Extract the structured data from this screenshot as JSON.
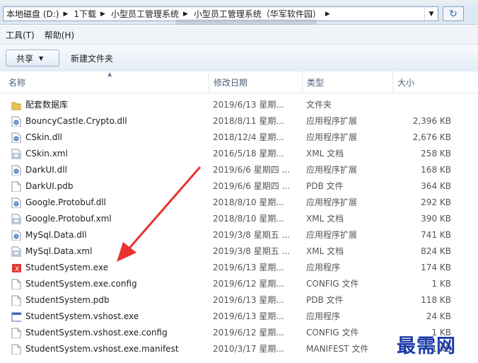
{
  "address": {
    "crumbs": [
      "本地磁盘 (D:)",
      "1下载",
      "小型员工管理系统",
      "小型员工管理系统（华军软件园）"
    ],
    "top_strip_text": "…"
  },
  "menu": [
    "工具(T)",
    "帮助(H)"
  ],
  "toolbar": {
    "share_label": "共享",
    "new_folder_label": "新建文件夹"
  },
  "columns": {
    "name": "名称",
    "date": "修改日期",
    "type": "类型",
    "size": "大小"
  },
  "files": [
    {
      "icon": "folder-icon",
      "name": "配套数据库",
      "date": "2019/6/13 星期...",
      "type": "文件夹",
      "size": ""
    },
    {
      "icon": "dll-file-icon",
      "name": "BouncyCastle.Crypto.dll",
      "date": "2018/8/11 星期...",
      "type": "应用程序扩展",
      "size": "2,396 KB"
    },
    {
      "icon": "dll-file-icon",
      "name": "CSkin.dll",
      "date": "2018/12/4 星期...",
      "type": "应用程序扩展",
      "size": "2,676 KB"
    },
    {
      "icon": "xml-file-icon",
      "name": "CSkin.xml",
      "date": "2016/5/18 星期...",
      "type": "XML 文档",
      "size": "258 KB"
    },
    {
      "icon": "dll-file-icon",
      "name": "DarkUI.dll",
      "date": "2019/6/6 星期四 ...",
      "type": "应用程序扩展",
      "size": "168 KB"
    },
    {
      "icon": "blank-file-icon",
      "name": "DarkUI.pdb",
      "date": "2019/6/6 星期四 ...",
      "type": "PDB 文件",
      "size": "364 KB"
    },
    {
      "icon": "dll-file-icon",
      "name": "Google.Protobuf.dll",
      "date": "2018/8/10 星期...",
      "type": "应用程序扩展",
      "size": "292 KB"
    },
    {
      "icon": "xml-file-icon",
      "name": "Google.Protobuf.xml",
      "date": "2018/8/10 星期...",
      "type": "XML 文档",
      "size": "390 KB"
    },
    {
      "icon": "dll-file-icon",
      "name": "MySql.Data.dll",
      "date": "2019/3/8 星期五 ...",
      "type": "应用程序扩展",
      "size": "741 KB"
    },
    {
      "icon": "xml-file-icon",
      "name": "MySql.Data.xml",
      "date": "2019/3/8 星期五 ...",
      "type": "XML 文档",
      "size": "824 KB"
    },
    {
      "icon": "exe-red-icon",
      "name": "StudentSystem.exe",
      "date": "2019/6/13 星期...",
      "type": "应用程序",
      "size": "174 KB"
    },
    {
      "icon": "blank-file-icon",
      "name": "StudentSystem.exe.config",
      "date": "2019/6/12 星期...",
      "type": "CONFIG 文件",
      "size": "1 KB"
    },
    {
      "icon": "blank-file-icon",
      "name": "StudentSystem.pdb",
      "date": "2019/6/13 星期...",
      "type": "PDB 文件",
      "size": "118 KB"
    },
    {
      "icon": "exe-window-icon",
      "name": "StudentSystem.vshost.exe",
      "date": "2019/6/13 星期...",
      "type": "应用程序",
      "size": "24 KB"
    },
    {
      "icon": "blank-file-icon",
      "name": "StudentSystem.vshost.exe.config",
      "date": "2019/6/12 星期...",
      "type": "CONFIG 文件",
      "size": "1 KB"
    },
    {
      "icon": "blank-file-icon",
      "name": "StudentSystem.vshost.exe.manifest",
      "date": "2010/3/17 星期...",
      "type": "MANIFEST 文件",
      "size": "1 KB"
    }
  ],
  "annotation": {
    "arrow_color": "#e8332f"
  },
  "watermark": "最需网"
}
